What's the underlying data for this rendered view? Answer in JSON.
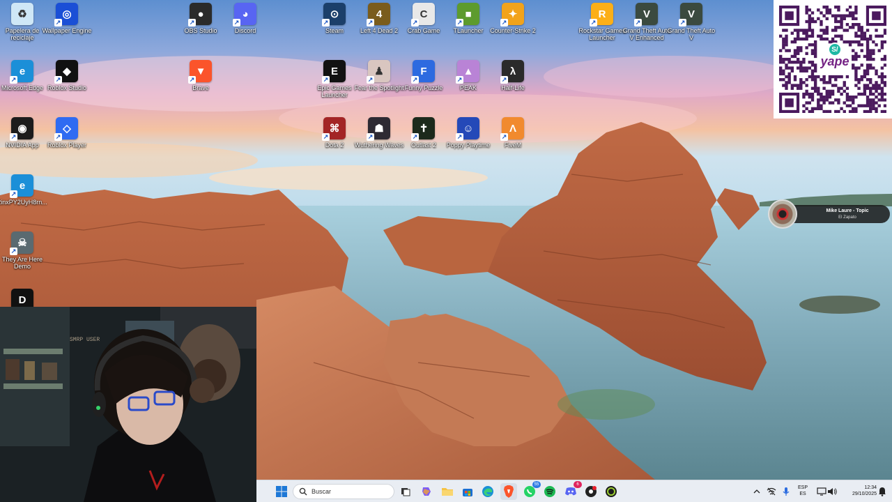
{
  "desktop": {
    "icons": [
      {
        "key": "recycle",
        "label": "Papelera de reciclaje",
        "color": "#cfe7f6",
        "glyph": "♻",
        "icon": "recycle-bin-icon"
      },
      {
        "key": "wallpaper",
        "label": "Wallpaper Engine",
        "color": "#1a4fd6",
        "glyph": "◎",
        "icon": "wallpaper-engine-icon"
      },
      {
        "key": "obs",
        "label": "OBS Studio",
        "color": "#2b2b2b",
        "glyph": "●",
        "icon": "obs-icon"
      },
      {
        "key": "discord",
        "label": "Discord",
        "color": "#5865f2",
        "glyph": "◕",
        "icon": "discord-icon"
      },
      {
        "key": "steam",
        "label": "Steam",
        "color": "#1b3f6a",
        "glyph": "⊙",
        "icon": "steam-icon"
      },
      {
        "key": "l4d2",
        "label": "Left 4 Dead 2",
        "color": "#7a5c1c",
        "glyph": "4",
        "icon": "left-4-dead-icon"
      },
      {
        "key": "crab",
        "label": "Crab Game",
        "color": "#e8e8e8",
        "glyph": "C",
        "icon": "crab-game-icon"
      },
      {
        "key": "tlauncher",
        "label": "TLauncher",
        "color": "#5d9b2e",
        "glyph": "■",
        "icon": "tlauncher-icon"
      },
      {
        "key": "cs2",
        "label": "Counter-Strike 2",
        "color": "#f2a31b",
        "glyph": "✦",
        "icon": "counter-strike-icon"
      },
      {
        "key": "rockstar",
        "label": "Rockstar Games Launcher",
        "color": "#fcaf17",
        "glyph": "R",
        "icon": "rockstar-icon"
      },
      {
        "key": "gta5e",
        "label": "Grand Theft Auto V Enhanced",
        "color": "#3b4a3f",
        "glyph": "V",
        "icon": "gta-v-enhanced-icon"
      },
      {
        "key": "gta5",
        "label": "Grand Theft Auto V",
        "color": "#3b4a3f",
        "glyph": "V",
        "icon": "gta-v-icon"
      },
      {
        "key": "edge",
        "label": "Microsoft Edge",
        "color": "#1b8fd8",
        "glyph": "e",
        "icon": "edge-icon"
      },
      {
        "key": "robloxstudio",
        "label": "Roblox Studio",
        "color": "#111111",
        "glyph": "◆",
        "icon": "roblox-studio-icon"
      },
      {
        "key": "brave",
        "label": "Brave",
        "color": "#fb542b",
        "glyph": "▼",
        "icon": "brave-icon"
      },
      {
        "key": "epic",
        "label": "Epic Games Launcher",
        "color": "#121212",
        "glyph": "E",
        "icon": "epic-games-icon"
      },
      {
        "key": "fear",
        "label": "Fear the Spotlight",
        "color": "#d9c6c0",
        "glyph": "♟",
        "icon": "fear-spotlight-icon"
      },
      {
        "key": "funny",
        "label": "Funny Puzzle",
        "color": "#2d6ae0",
        "glyph": "F",
        "icon": "funny-puzzle-icon"
      },
      {
        "key": "peak",
        "label": "PEAK",
        "color": "#b983d6",
        "glyph": "▲",
        "icon": "peak-icon"
      },
      {
        "key": "halflife",
        "label": "Half-Life",
        "color": "#2a2a2a",
        "glyph": "λ",
        "icon": "half-life-icon"
      },
      {
        "key": "nvidia",
        "label": "NVIDIA App",
        "color": "#1c1c1c",
        "glyph": "◉",
        "icon": "nvidia-icon"
      },
      {
        "key": "robloxplayer",
        "label": "Roblox Player",
        "color": "#2f6bf2",
        "glyph": "◇",
        "icon": "roblox-player-icon"
      },
      {
        "key": "dota",
        "label": "Dota 2",
        "color": "#a32525",
        "glyph": "⌘",
        "icon": "dota-2-icon"
      },
      {
        "key": "wuthering",
        "label": "Wuthering Waves",
        "color": "#2e2a33",
        "glyph": "☗",
        "icon": "wuthering-waves-icon"
      },
      {
        "key": "outlast",
        "label": "Outlast 2",
        "color": "#1c2a1c",
        "glyph": "✝",
        "icon": "outlast-icon"
      },
      {
        "key": "poppy",
        "label": "Poppy Playtime",
        "color": "#2449b8",
        "glyph": "☺",
        "icon": "poppy-playtime-icon"
      },
      {
        "key": "fivem",
        "label": "FiveM",
        "color": "#f18a2e",
        "glyph": "Λ",
        "icon": "fivem-icon"
      },
      {
        "key": "edgeshort",
        "label": "2inxPY2UyH8rn...",
        "color": "#1b8fd8",
        "glyph": "e",
        "icon": "edge-shortcut-icon"
      },
      {
        "key": "theyare",
        "label": "They Are Here Demo",
        "color": "#5a6a70",
        "glyph": "☠",
        "icon": "they-are-here-icon"
      },
      {
        "key": "dmisc",
        "label": "",
        "color": "#111111",
        "glyph": "D",
        "icon": "app-d-icon"
      }
    ]
  },
  "qr_widget": {
    "brand": "yape",
    "badge": "S/",
    "icon": "qr-code-icon"
  },
  "music_widget": {
    "title": "Mike Laure - Topic",
    "subtitle": "El Zapato",
    "icon": "album-disc-icon"
  },
  "webcam": {
    "caption": "SMRP USER"
  },
  "taskbar": {
    "search_placeholder": "Buscar",
    "apps": [
      {
        "name": "start",
        "icon": "windows-start-icon"
      },
      {
        "name": "task-view",
        "icon": "task-view-icon"
      },
      {
        "name": "copilot",
        "icon": "copilot-icon"
      },
      {
        "name": "file-explorer",
        "icon": "folder-icon"
      },
      {
        "name": "store",
        "icon": "store-icon"
      },
      {
        "name": "edge",
        "icon": "edge-icon"
      },
      {
        "name": "brave",
        "icon": "brave-icon"
      },
      {
        "name": "whatsapp",
        "icon": "whatsapp-icon",
        "badge": "55"
      },
      {
        "name": "spotify",
        "icon": "spotify-icon"
      },
      {
        "name": "discord",
        "icon": "discord-icon",
        "badge": "6"
      },
      {
        "name": "app-red",
        "icon": "recording-app-icon"
      },
      {
        "name": "app-green",
        "icon": "game-app-icon"
      }
    ],
    "tray": {
      "lang_top": "ESP",
      "lang_bottom": "ES",
      "time": "12:34",
      "date": "29/10/2025"
    }
  }
}
